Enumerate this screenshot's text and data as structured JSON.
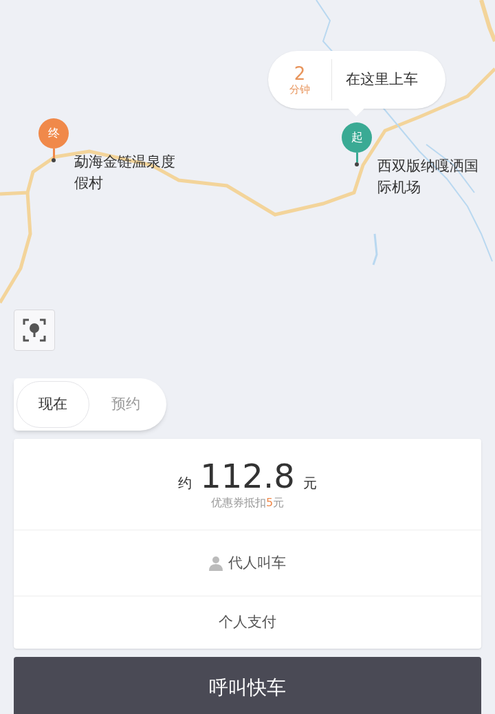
{
  "eta_bubble": {
    "minutes": "2",
    "unit": "分钟",
    "label": "在这里上车"
  },
  "markers": [
    {
      "kind": "end",
      "glyph": "终",
      "color": "#f0894a",
      "name": "勐海金链温泉度假村"
    },
    {
      "kind": "start",
      "glyph": "起",
      "color": "#3aaa94",
      "name": "西双版纳嘎洒国际机场"
    }
  ],
  "time_tabs": [
    {
      "label": "现在",
      "selected": true
    },
    {
      "label": "预约",
      "selected": false
    }
  ],
  "fare": {
    "prefix": "约",
    "amount": "112.8",
    "unit": "元",
    "coupon": {
      "before": "优惠券抵扣",
      "amount": "5",
      "after": "元"
    }
  },
  "options": [
    {
      "kind": "person",
      "label": "代人叫车"
    },
    {
      "kind": "plain",
      "label": "个人支付"
    }
  ],
  "call_button": "呼叫快车"
}
